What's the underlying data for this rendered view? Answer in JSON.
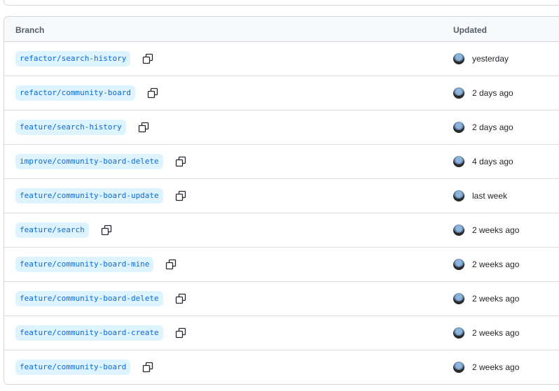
{
  "table": {
    "header": {
      "branch_label": "Branch",
      "updated_label": "Updated"
    },
    "rows": [
      {
        "branch": "refactor/search-history",
        "updated": "yesterday"
      },
      {
        "branch": "refactor/community-board",
        "updated": "2 days ago"
      },
      {
        "branch": "feature/search-history",
        "updated": "2 days ago"
      },
      {
        "branch": "improve/community-board-delete",
        "updated": "4 days ago"
      },
      {
        "branch": "feature/community-board-update",
        "updated": "last week"
      },
      {
        "branch": "feature/search",
        "updated": "2 weeks ago"
      },
      {
        "branch": "feature/community-board-mine",
        "updated": "2 weeks ago"
      },
      {
        "branch": "feature/community-board-delete",
        "updated": "2 weeks ago"
      },
      {
        "branch": "feature/community-board-create",
        "updated": "2 weeks ago"
      },
      {
        "branch": "feature/community-board",
        "updated": "2 weeks ago"
      }
    ]
  },
  "icons": {
    "copy": "copy-icon",
    "avatar": "user-avatar"
  },
  "colors": {
    "branch_bg": "#ddf4ff",
    "branch_text": "#0969da",
    "border": "#d0d7de",
    "header_bg": "#f6f8fa"
  }
}
